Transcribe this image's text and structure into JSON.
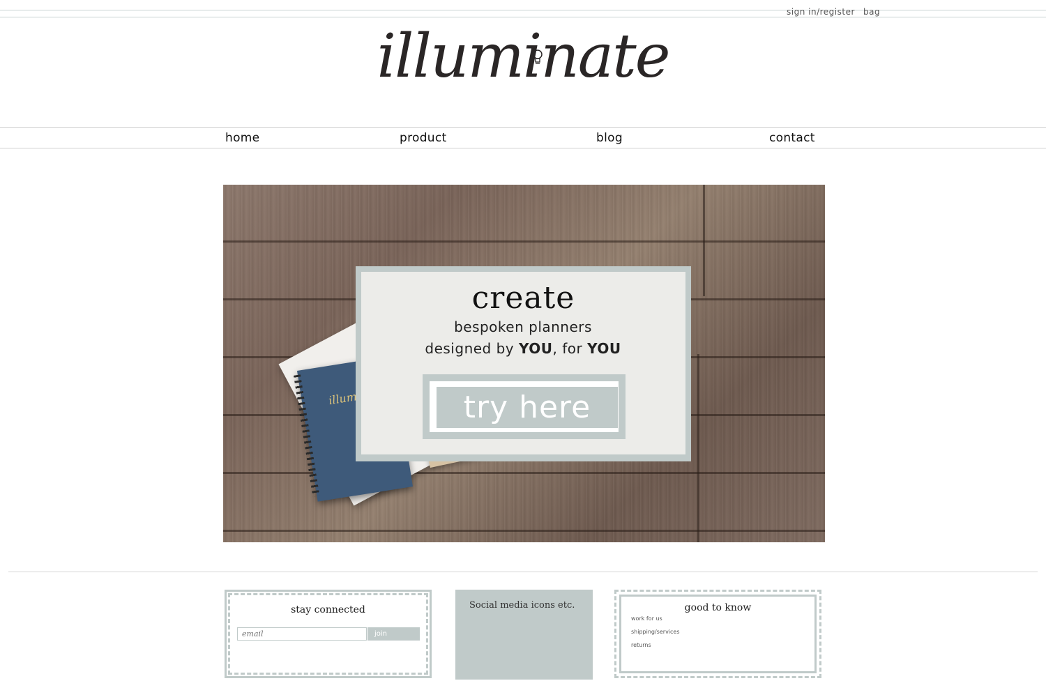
{
  "top_bar": {
    "sign_in_label": "sign in/register",
    "bag_label": "bag"
  },
  "logo": {
    "text": "illuminate",
    "icon": "lightbulb-icon"
  },
  "nav": {
    "items": [
      {
        "label": "home"
      },
      {
        "label": "product"
      },
      {
        "label": "blog"
      },
      {
        "label": "contact"
      }
    ]
  },
  "hero": {
    "notebook_label": "illuminate",
    "headline": "create",
    "line1": "bespoken planners",
    "line2_pre": "designed by ",
    "line2_you1": "YOU",
    "line2_mid": ", for ",
    "line2_you2": "YOU",
    "cta_label": "try here"
  },
  "footer": {
    "stay_connected": {
      "title": "stay connected",
      "email_placeholder": "email",
      "join_label": "join"
    },
    "social": {
      "text": "Social media icons etc."
    },
    "good_to_know": {
      "title": "good to know",
      "links": [
        "work for us",
        "shipping/services",
        "returns"
      ]
    }
  },
  "colors": {
    "accent": "#c0cac9",
    "text": "#1c1c1c",
    "wood": "#7f6b60",
    "notebook": "#3e5a7a"
  }
}
